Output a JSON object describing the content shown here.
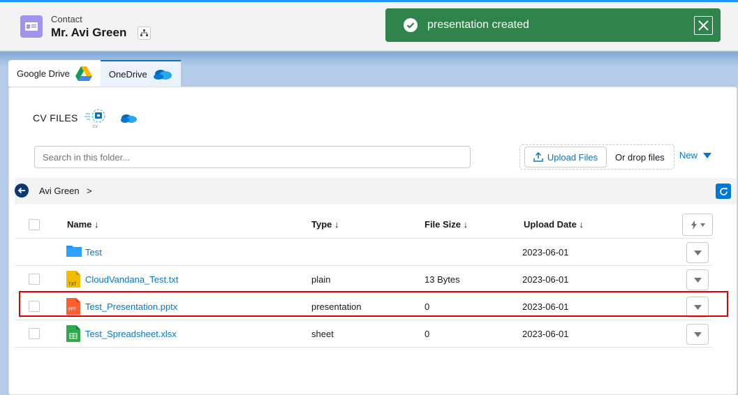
{
  "header": {
    "object_type": "Contact",
    "record_name": "Mr. Avi Green"
  },
  "toast": {
    "message": "presentation created",
    "color": "#2e844a"
  },
  "tabs": [
    {
      "label": "Google Drive",
      "icon": "google-drive-icon",
      "active": false
    },
    {
      "label": "OneDrive",
      "icon": "onedrive-icon",
      "active": true
    }
  ],
  "panel": {
    "title": "CV FILES",
    "search_placeholder": "Search in this folder...",
    "upload_label": "Upload Files",
    "drop_label": "Or drop files",
    "new_label": "New"
  },
  "breadcrumb": {
    "items": [
      "Avi Green"
    ],
    "separator": ">"
  },
  "table": {
    "columns": [
      "Name",
      "Type",
      "File Size",
      "Upload Date"
    ],
    "rows": [
      {
        "name": "Test",
        "type": "",
        "size": "",
        "date": "2023-06-01",
        "icon": "folder-icon",
        "checkbox": false
      },
      {
        "name": "CloudVandana_Test.txt",
        "type": "plain",
        "size": "13 Bytes",
        "date": "2023-06-01",
        "icon": "txt-file-icon",
        "checkbox": true
      },
      {
        "name": "Test_Presentation.pptx",
        "type": "presentation",
        "size": "0",
        "date": "2023-06-01",
        "icon": "ppt-file-icon",
        "checkbox": true
      },
      {
        "name": "Test_Spreadsheet.xlsx",
        "type": "sheet",
        "size": "0",
        "date": "2023-06-01",
        "icon": "sheet-file-icon",
        "checkbox": true
      }
    ]
  }
}
